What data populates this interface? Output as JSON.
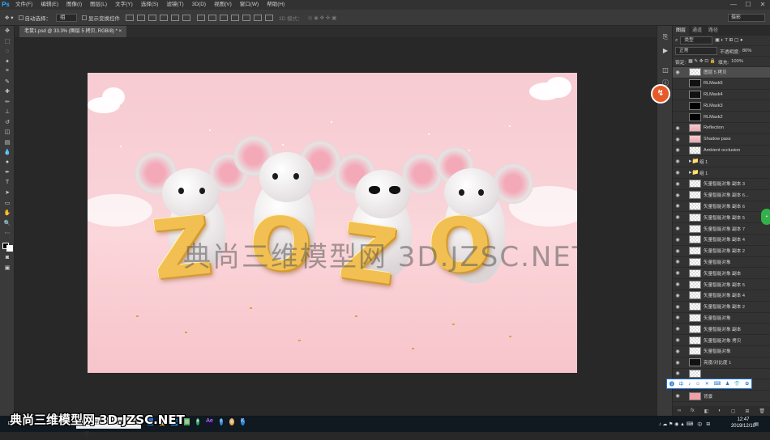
{
  "app": {
    "logo": "Ps"
  },
  "menu": {
    "items": [
      "文件(F)",
      "编辑(E)",
      "图像(I)",
      "图层(L)",
      "文字(Y)",
      "选择(S)",
      "滤镜(T)",
      "3D(D)",
      "视图(V)",
      "窗口(W)",
      "帮助(H)"
    ],
    "window_controls": [
      "—",
      "☐",
      "✕"
    ]
  },
  "options": {
    "auto_select_label": "自动选择：",
    "auto_select_value": "组",
    "show_transform_label": "显示变换控件",
    "mode_3d_label": "3D 模式：",
    "workspace_value": "摄影"
  },
  "tab": {
    "title": "老鼠1.psd @ 33.3% (图层 5 拷贝, RGB/8) *",
    "close": "×"
  },
  "canvas": {
    "watermark": "典尚三维模型网 3D.JZSC.NET",
    "letters": [
      "Z",
      "O",
      "Z",
      "O"
    ]
  },
  "layers_panel": {
    "tabs": [
      "图层",
      "通道",
      "路径"
    ],
    "filter_label": "类型",
    "blend_mode": "正常",
    "opacity_label": "不透明度:",
    "opacity_value": "80%",
    "lock_label": "锁定:",
    "fill_label": "填充:",
    "fill_value": "100%",
    "layers": [
      {
        "name": "图层 5 拷贝",
        "thumb": "checker",
        "visible": true,
        "selected": true
      },
      {
        "name": "RLMask5",
        "thumb": "mask",
        "visible": false
      },
      {
        "name": "RLMask4",
        "thumb": "mask",
        "visible": false
      },
      {
        "name": "RLMask3",
        "thumb": "black",
        "visible": false
      },
      {
        "name": "RLMask2",
        "thumb": "black",
        "visible": false
      },
      {
        "name": "Reflection",
        "thumb": "scene",
        "visible": true
      },
      {
        "name": "Shadow pass",
        "thumb": "scene",
        "visible": true
      },
      {
        "name": "Ambient occlusion",
        "thumb": "checker",
        "visible": true
      },
      {
        "name": "组 1",
        "thumb": "folder",
        "visible": true
      },
      {
        "name": "组 1",
        "thumb": "folder",
        "visible": true
      },
      {
        "name": "矢量智能对象 副本 3",
        "thumb": "checker",
        "visible": true
      },
      {
        "name": "矢量智能对象 副本 6...",
        "thumb": "checker",
        "visible": true
      },
      {
        "name": "矢量智能对象 副本 6",
        "thumb": "checker",
        "visible": true
      },
      {
        "name": "矢量智能对象 副本 5",
        "thumb": "checker",
        "visible": true
      },
      {
        "name": "矢量智能对象 副本 7",
        "thumb": "checker",
        "visible": true
      },
      {
        "name": "矢量智能对象 副本 4",
        "thumb": "checker",
        "visible": true
      },
      {
        "name": "矢量智能对象 副本 2",
        "thumb": "checker",
        "visible": true
      },
      {
        "name": "矢量智能对象",
        "thumb": "checker",
        "visible": true
      },
      {
        "name": "矢量智能对象 副本",
        "thumb": "checker",
        "visible": true
      },
      {
        "name": "矢量智能对象 副本 5",
        "thumb": "checker",
        "visible": true
      },
      {
        "name": "矢量智能对象 副本 4",
        "thumb": "checker",
        "visible": true
      },
      {
        "name": "矢量智能对象 副本 2",
        "thumb": "checker",
        "visible": true
      },
      {
        "name": "矢量智能对象",
        "thumb": "checker",
        "visible": true
      },
      {
        "name": "矢量智能对象 副本",
        "thumb": "checker",
        "visible": true
      },
      {
        "name": "矢量智能对象 拷贝",
        "thumb": "checker",
        "visible": true
      },
      {
        "name": "矢量智能对象",
        "thumb": "checker",
        "visible": true
      },
      {
        "name": "亮度/对比度 1",
        "thumb": "mask",
        "visible": true
      },
      {
        "name": "",
        "thumb": "checker",
        "visible": true
      },
      {
        "name": "背景 拷贝",
        "thumb": "pink",
        "visible": true
      },
      {
        "name": "背景",
        "thumb": "pink",
        "visible": true
      }
    ],
    "bottom_icons": [
      "∞",
      "fx",
      "◧",
      "◐",
      "▢",
      "⊞",
      "🗑"
    ]
  },
  "float_toolbar": [
    "中",
    "♪",
    "☺",
    "✕",
    "⌨",
    "♟",
    "👕",
    "✿"
  ],
  "taskbar": {
    "search_text": "在这里输入你要搜索的内容",
    "watermark": "典尚三维模型网 3D.JZSC.NET",
    "tray_lang": "中",
    "time": "12:47",
    "date": "2019/12/10"
  },
  "colors": {
    "accent": "#31a8ff",
    "canvas_bg": "#f7cbd2",
    "panel_bg": "#333333"
  }
}
